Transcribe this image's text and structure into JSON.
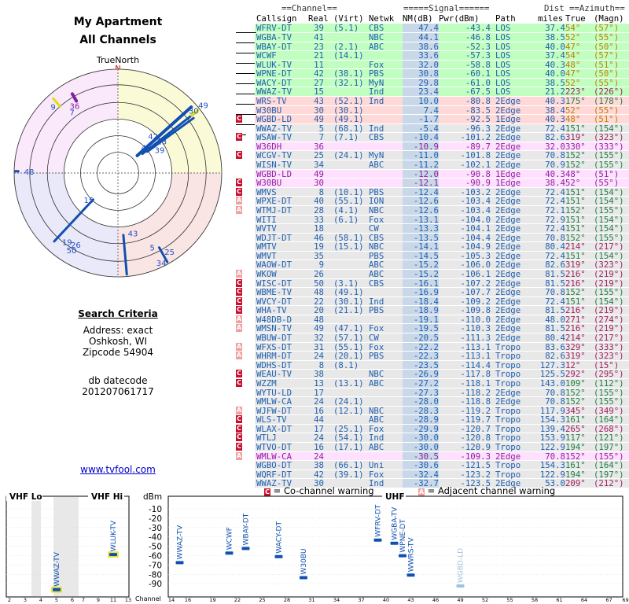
{
  "header": {
    "title1": "My Apartment",
    "title2": "All Channels",
    "truenorth": "TrueNorth",
    "north": "N"
  },
  "criteria": {
    "heading": "Search Criteria",
    "address": "Address: exact",
    "city": "Oshkosh, WI",
    "zip": "Zipcode 54904",
    "db1": "db datecode",
    "db2": "201207061717"
  },
  "link": "www.tvfool.com",
  "table_headers": {
    "g_channel": "==Channel==",
    "g_signal": "=====Signal======",
    "g_dist": "Dist",
    "g_azimuth": "==Azimuth==",
    "callsign": "Callsign",
    "real": "Real",
    "virt": "(Virt)",
    "netwk": "Netwk",
    "nm": "NM(dB)",
    "pwr": "Pwr(dBm)",
    "path": "Path",
    "miles": "miles",
    "true": "True",
    "magn": "(Magn)"
  },
  "colors": {
    "green": "#c0ffc0",
    "yellow": "#ffffc0",
    "red": "#ffd8d8",
    "pink": "#ffe0ff",
    "gray": "#e8e8e8",
    "nm_col": "#c8d8e8",
    "blue": "#2050c0",
    "text_blue": "#2060b0"
  },
  "stations": [
    {
      "call": "WFRV-DT",
      "real": "39",
      "virt": "(5.1)",
      "net": "CBS",
      "nm": "47.4",
      "pwr": "-43.4",
      "path": "LOS",
      "dist": "37.4",
      "az": "54°",
      "mag": "(57°)",
      "band": "green",
      "mark": ""
    },
    {
      "call": "WGBA-TV",
      "real": "41",
      "virt": "",
      "net": "NBC",
      "nm": "44.1",
      "pwr": "-46.8",
      "path": "LOS",
      "dist": "38.5",
      "az": "52°",
      "mag": "(55°)",
      "band": "green",
      "mark": ""
    },
    {
      "call": "WBAY-DT",
      "real": "23",
      "virt": "(2.1)",
      "net": "ABC",
      "nm": "38.6",
      "pwr": "-52.3",
      "path": "LOS",
      "dist": "40.0",
      "az": "47°",
      "mag": "(50°)",
      "band": "green",
      "mark": ""
    },
    {
      "call": "WCWF",
      "real": "21",
      "virt": "(14.1)",
      "net": "",
      "nm": "33.6",
      "pwr": "-57.3",
      "path": "LOS",
      "dist": "37.4",
      "az": "54°",
      "mag": "(57°)",
      "band": "green",
      "mark": ""
    },
    {
      "call": "WLUK-TV",
      "real": "11",
      "virt": "",
      "net": "Fox",
      "nm": "32.0",
      "pwr": "-58.8",
      "path": "LOS",
      "dist": "40.3",
      "az": "48°",
      "mag": "(51°)",
      "band": "green",
      "mark": ""
    },
    {
      "call": "WPNE-DT",
      "real": "42",
      "virt": "(38.1)",
      "net": "PBS",
      "nm": "30.8",
      "pwr": "-60.1",
      "path": "LOS",
      "dist": "40.0",
      "az": "47°",
      "mag": "(50°)",
      "band": "green",
      "mark": ""
    },
    {
      "call": "WACY-DT",
      "real": "27",
      "virt": "(32.1)",
      "net": "MyN",
      "nm": "29.8",
      "pwr": "-61.0",
      "path": "LOS",
      "dist": "38.5",
      "az": "52°",
      "mag": "(55°)",
      "band": "green",
      "mark": ""
    },
    {
      "call": "WWAZ-TV",
      "real": "15",
      "virt": "",
      "net": "Ind",
      "nm": "23.4",
      "pwr": "-67.5",
      "path": "LOS",
      "dist": "21.2",
      "az": "223°",
      "mag": "(226°)",
      "band": "green",
      "mark": ""
    },
    {
      "call": "WRS-TV",
      "real": "43",
      "virt": "(52.1)",
      "net": "Ind",
      "nm": "10.0",
      "pwr": "-80.8",
      "path": "2Edge",
      "dist": "40.3",
      "az": "175°",
      "mag": "(178°)",
      "band": "red",
      "mark": ""
    },
    {
      "call": "W30BU",
      "real": "30",
      "virt": "(30.1)",
      "net": "",
      "nm": "7.4",
      "pwr": "-83.5",
      "path": "2Edge",
      "dist": "38.4",
      "az": "52°",
      "mag": "(55°)",
      "band": "red",
      "mark": ""
    },
    {
      "call": "WGBD-LD",
      "real": "49",
      "virt": "(49.1)",
      "net": "",
      "nm": "-1.7",
      "pwr": "-92.5",
      "path": "1Edge",
      "dist": "40.3",
      "az": "48°",
      "mag": "(51°)",
      "band": "red",
      "mark": "C"
    },
    {
      "call": "WWAZ-TV",
      "real": "5",
      "virt": "(68.1)",
      "net": "Ind",
      "nm": "-5.4",
      "pwr": "-96.3",
      "path": "2Edge",
      "dist": "72.4",
      "az": "151°",
      "mag": "(154°)",
      "band": "gray",
      "mark": ""
    },
    {
      "call": "WSAW-TV",
      "real": "7",
      "virt": "(7.1)",
      "net": "CBS",
      "nm": "-10.4",
      "pwr": "-101.2",
      "path": "2Edge",
      "dist": "82.6",
      "az": "319°",
      "mag": "(323°)",
      "band": "gray",
      "mark": "C"
    },
    {
      "call": "W36DH",
      "real": "36",
      "virt": "",
      "net": "",
      "nm": "-10.9",
      "pwr": "-89.7",
      "path": "2Edge",
      "dist": "32.0",
      "az": "330°",
      "mag": "(333°)",
      "band": "pink",
      "mark": ""
    },
    {
      "call": "WCGV-TV",
      "real": "25",
      "virt": "(24.1)",
      "net": "MyN",
      "nm": "-11.0",
      "pwr": "-101.8",
      "path": "2Edge",
      "dist": "70.8",
      "az": "152°",
      "mag": "(155°)",
      "band": "gray",
      "mark": "C"
    },
    {
      "call": "WISN-TV",
      "real": "34",
      "virt": "",
      "net": "ABC",
      "nm": "-11.2",
      "pwr": "-102.1",
      "path": "2Edge",
      "dist": "70.9",
      "az": "152°",
      "mag": "(155°)",
      "band": "gray",
      "mark": ""
    },
    {
      "call": "WGBD-LD",
      "real": "49",
      "virt": "",
      "net": "",
      "nm": "-12.0",
      "pwr": "-90.8",
      "path": "1Edge",
      "dist": "40.3",
      "az": "48°",
      "mag": "(51°)",
      "band": "pink",
      "mark": ""
    },
    {
      "call": "W30BU",
      "real": "30",
      "virt": "",
      "net": "",
      "nm": "-12.1",
      "pwr": "-90.9",
      "path": "1Edge",
      "dist": "38.4",
      "az": "52°",
      "mag": "(55°)",
      "band": "pink",
      "mark": "C"
    },
    {
      "call": "WMVS",
      "real": "8",
      "virt": "(10.1)",
      "net": "PBS",
      "nm": "-12.4",
      "pwr": "-103.2",
      "path": "2Edge",
      "dist": "72.4",
      "az": "151°",
      "mag": "(154°)",
      "band": "gray",
      "mark": "C"
    },
    {
      "call": "WPXE-DT",
      "real": "40",
      "virt": "(55.1)",
      "net": "ION",
      "nm": "-12.6",
      "pwr": "-103.4",
      "path": "2Edge",
      "dist": "72.4",
      "az": "151°",
      "mag": "(154°)",
      "band": "gray",
      "mark": "A"
    },
    {
      "call": "WTMJ-DT",
      "real": "28",
      "virt": "(4.1)",
      "net": "NBC",
      "nm": "-12.6",
      "pwr": "-103.4",
      "path": "2Edge",
      "dist": "72.1",
      "az": "152°",
      "mag": "(155°)",
      "band": "gray",
      "mark": "A"
    },
    {
      "call": "WITI",
      "real": "33",
      "virt": "(6.1)",
      "net": "Fox",
      "nm": "-13.1",
      "pwr": "-104.0",
      "path": "2Edge",
      "dist": "72.9",
      "az": "151°",
      "mag": "(154°)",
      "band": "gray",
      "mark": ""
    },
    {
      "call": "WVTV",
      "real": "18",
      "virt": "",
      "net": "CW",
      "nm": "-13.3",
      "pwr": "-104.1",
      "path": "2Edge",
      "dist": "72.4",
      "az": "151°",
      "mag": "(154°)",
      "band": "gray",
      "mark": ""
    },
    {
      "call": "WDJT-DT",
      "real": "46",
      "virt": "(58.1)",
      "net": "CBS",
      "nm": "-13.5",
      "pwr": "-104.4",
      "path": "2Edge",
      "dist": "70.8",
      "az": "152°",
      "mag": "(155°)",
      "band": "gray",
      "mark": ""
    },
    {
      "call": "WMTV",
      "real": "19",
      "virt": "(15.1)",
      "net": "NBC",
      "nm": "-14.1",
      "pwr": "-104.9",
      "path": "2Edge",
      "dist": "80.4",
      "az": "214°",
      "mag": "(217°)",
      "band": "gray",
      "mark": ""
    },
    {
      "call": "WMVT",
      "real": "35",
      "virt": "",
      "net": "PBS",
      "nm": "-14.5",
      "pwr": "-105.3",
      "path": "2Edge",
      "dist": "72.4",
      "az": "151°",
      "mag": "(154°)",
      "band": "gray",
      "mark": ""
    },
    {
      "call": "WAOW-DT",
      "real": "9",
      "virt": "",
      "net": "ABC",
      "nm": "-15.2",
      "pwr": "-106.0",
      "path": "2Edge",
      "dist": "82.6",
      "az": "319°",
      "mag": "(323°)",
      "band": "gray",
      "mark": ""
    },
    {
      "call": "WKOW",
      "real": "26",
      "virt": "",
      "net": "ABC",
      "nm": "-15.2",
      "pwr": "-106.1",
      "path": "2Edge",
      "dist": "81.5",
      "az": "216°",
      "mag": "(219°)",
      "band": "gray",
      "mark": "A"
    },
    {
      "call": "WISC-DT",
      "real": "50",
      "virt": "(3.1)",
      "net": "CBS",
      "nm": "-16.1",
      "pwr": "-107.2",
      "path": "2Edge",
      "dist": "81.5",
      "az": "216°",
      "mag": "(219°)",
      "band": "gray",
      "mark": "C"
    },
    {
      "call": "WBME-TV",
      "real": "48",
      "virt": "(49.1)",
      "net": "",
      "nm": "-16.9",
      "pwr": "-107.7",
      "path": "2Edge",
      "dist": "70.8",
      "az": "152°",
      "mag": "(155°)",
      "band": "gray",
      "mark": "C"
    },
    {
      "call": "WVCY-DT",
      "real": "22",
      "virt": "(30.1)",
      "net": "Ind",
      "nm": "-18.4",
      "pwr": "-109.2",
      "path": "2Edge",
      "dist": "72.4",
      "az": "151°",
      "mag": "(154°)",
      "band": "gray",
      "mark": "C"
    },
    {
      "call": "WHA-TV",
      "real": "20",
      "virt": "(21.1)",
      "net": "PBS",
      "nm": "-18.9",
      "pwr": "-109.8",
      "path": "2Edge",
      "dist": "81.5",
      "az": "216°",
      "mag": "(219°)",
      "band": "gray",
      "mark": "C"
    },
    {
      "call": "W48DB-D",
      "real": "48",
      "virt": "",
      "net": "",
      "nm": "-19.1",
      "pwr": "-110.0",
      "path": "2Edge",
      "dist": "48.0",
      "az": "271°",
      "mag": "(274°)",
      "band": "gray",
      "mark": "A"
    },
    {
      "call": "WMSN-TV",
      "real": "49",
      "virt": "(47.1)",
      "net": "Fox",
      "nm": "-19.5",
      "pwr": "-110.3",
      "path": "2Edge",
      "dist": "81.5",
      "az": "216°",
      "mag": "(219°)",
      "band": "gray",
      "mark": "A"
    },
    {
      "call": "WBUW-DT",
      "real": "32",
      "virt": "(57.1)",
      "net": "CW",
      "nm": "-20.5",
      "pwr": "-111.3",
      "path": "2Edge",
      "dist": "80.4",
      "az": "214°",
      "mag": "(217°)",
      "band": "gray",
      "mark": ""
    },
    {
      "call": "WFXS-DT",
      "real": "31",
      "virt": "(55.1)",
      "net": "Fox",
      "nm": "-22.2",
      "pwr": "-113.1",
      "path": "Tropo",
      "dist": "83.6",
      "az": "329°",
      "mag": "(333°)",
      "band": "gray",
      "mark": "A"
    },
    {
      "call": "WHRM-DT",
      "real": "24",
      "virt": "(20.1)",
      "net": "PBS",
      "nm": "-22.3",
      "pwr": "-113.1",
      "path": "Tropo",
      "dist": "82.6",
      "az": "319°",
      "mag": "(323°)",
      "band": "gray",
      "mark": "A"
    },
    {
      "call": "WDHS-DT",
      "real": "8",
      "virt": "(8.1)",
      "net": "",
      "nm": "-23.5",
      "pwr": "-114.4",
      "path": "Tropo",
      "dist": "127.3",
      "az": "12°",
      "mag": "(15°)",
      "band": "gray",
      "mark": ""
    },
    {
      "call": "WEAU-TV",
      "real": "38",
      "virt": "",
      "net": "NBC",
      "nm": "-26.9",
      "pwr": "-117.8",
      "path": "Tropo",
      "dist": "125.5",
      "az": "292°",
      "mag": "(295°)",
      "band": "gray",
      "mark": "C"
    },
    {
      "call": "WZZM",
      "real": "13",
      "virt": "(13.1)",
      "net": "ABC",
      "nm": "-27.2",
      "pwr": "-118.1",
      "path": "Tropo",
      "dist": "143.0",
      "az": "109°",
      "mag": "(112°)",
      "band": "gray",
      "mark": "C"
    },
    {
      "call": "WYTU-LD",
      "real": "17",
      "virt": "",
      "net": "",
      "nm": "-27.3",
      "pwr": "-118.2",
      "path": "2Edge",
      "dist": "70.8",
      "az": "152°",
      "mag": "(155°)",
      "band": "gray",
      "mark": ""
    },
    {
      "call": "WMLW-CA",
      "real": "24",
      "virt": "(24.1)",
      "net": "",
      "nm": "-28.0",
      "pwr": "-118.8",
      "path": "2Edge",
      "dist": "70.8",
      "az": "152°",
      "mag": "(155°)",
      "band": "gray",
      "mark": ""
    },
    {
      "call": "WJFW-DT",
      "real": "16",
      "virt": "(12.1)",
      "net": "NBC",
      "nm": "-28.3",
      "pwr": "-119.2",
      "path": "Tropo",
      "dist": "117.9",
      "az": "345°",
      "mag": "(349°)",
      "band": "gray",
      "mark": "A"
    },
    {
      "call": "WLS-TV",
      "real": "44",
      "virt": "",
      "net": "ABC",
      "nm": "-28.9",
      "pwr": "-119.7",
      "path": "Tropo",
      "dist": "154.3",
      "az": "161°",
      "mag": "(164°)",
      "band": "gray",
      "mark": "C"
    },
    {
      "call": "WLAX-DT",
      "real": "17",
      "virt": "(25.1)",
      "net": "Fox",
      "nm": "-29.9",
      "pwr": "-120.7",
      "path": "Tropo",
      "dist": "139.4",
      "az": "265°",
      "mag": "(268°)",
      "band": "gray",
      "mark": "C"
    },
    {
      "call": "WTLJ",
      "real": "24",
      "virt": "(54.1)",
      "net": "Ind",
      "nm": "-30.0",
      "pwr": "-120.8",
      "path": "Tropo",
      "dist": "153.9",
      "az": "117°",
      "mag": "(121°)",
      "band": "gray",
      "mark": "C"
    },
    {
      "call": "WTVO-DT",
      "real": "16",
      "virt": "(17.1)",
      "net": "ABC",
      "nm": "-30.0",
      "pwr": "-120.9",
      "path": "Tropo",
      "dist": "122.9",
      "az": "194°",
      "mag": "(197°)",
      "band": "gray",
      "mark": "C"
    },
    {
      "call": "WMLW-CA",
      "real": "24",
      "virt": "",
      "net": "",
      "nm": "-30.5",
      "pwr": "-109.3",
      "path": "2Edge",
      "dist": "70.8",
      "az": "152°",
      "mag": "(155°)",
      "band": "pink",
      "mark": "A"
    },
    {
      "call": "WGBO-DT",
      "real": "38",
      "virt": "(66.1)",
      "net": "Uni",
      "nm": "-30.6",
      "pwr": "-121.5",
      "path": "Tropo",
      "dist": "154.3",
      "az": "161°",
      "mag": "(164°)",
      "band": "gray",
      "mark": ""
    },
    {
      "call": "WQRF-DT",
      "real": "42",
      "virt": "(39.1)",
      "net": "Fox",
      "nm": "-32.4",
      "pwr": "-123.2",
      "path": "Tropo",
      "dist": "122.9",
      "az": "194°",
      "mag": "(197°)",
      "band": "gray",
      "mark": ""
    },
    {
      "call": "WWAZ-TV",
      "real": "30",
      "virt": "",
      "net": "Ind",
      "nm": "-32.7",
      "pwr": "-123.5",
      "path": "2Edge",
      "dist": "53.0",
      "az": "209°",
      "mag": "(212°)",
      "band": "gray",
      "mark": ""
    }
  ],
  "radar_labels": [
    {
      "text": "36",
      "az": 330,
      "r": 0.75,
      "color": "#8020a0"
    },
    {
      "text": "39",
      "az": 54,
      "r": 0.38,
      "color": "#2050c0"
    },
    {
      "text": "41",
      "az": 52,
      "r": 0.4,
      "color": "#2050c0"
    },
    {
      "text": "23",
      "az": 47,
      "r": 0.45,
      "color": "#2050c0"
    },
    {
      "text": "42",
      "az": 47,
      "r": 0.52,
      "color": "#2050c0"
    },
    {
      "text": "49",
      "az": 48,
      "r": 0.98,
      "color": "#2050c0"
    },
    {
      "text": "30",
      "az": 52,
      "r": 0.98,
      "color": "#2050c0"
    },
    {
      "text": "48",
      "az": 271,
      "r": 0.95,
      "color": "#2050c0"
    },
    {
      "text": "15",
      "az": 223,
      "r": 0.35,
      "color": "#2050c0"
    },
    {
      "text": "43",
      "az": 175,
      "r": 0.58,
      "color": "#2050c0"
    },
    {
      "text": "5",
      "az": 151,
      "r": 0.82,
      "color": "#2050c0"
    },
    {
      "text": "25",
      "az": 152,
      "r": 0.86,
      "color": "#2050c0"
    },
    {
      "text": "34",
      "az": 152,
      "r": 0.98,
      "color": "#2050c0"
    },
    {
      "text": "26",
      "az": 216,
      "r": 0.85,
      "color": "#2050c0"
    },
    {
      "text": "19",
      "az": 214,
      "r": 0.8,
      "color": "#2050c0"
    },
    {
      "text": "50",
      "az": 216,
      "r": 0.92,
      "color": "#2050c0"
    },
    {
      "text": "9",
      "az": 319,
      "r": 0.85,
      "color": "#2050c0"
    },
    {
      "text": "7",
      "az": 319,
      "r": 0.78,
      "color": "#2050c0"
    }
  ],
  "bottom": {
    "vhf_lo": "VHF Lo",
    "vhf_hi": "VHF Hi",
    "uhf": "UHF",
    "dbm": "dBm",
    "channel": "Channel",
    "legend_co": "= Co-channel warning",
    "legend_adj": "= Adjacent channel warning",
    "legend_c": "C",
    "legend_a": "A",
    "dbm_ticks": [
      "-10",
      "-20",
      "-30",
      "-40",
      "-50",
      "-60",
      "-70",
      "-80",
      "-90"
    ],
    "vhf_lo_ticks": [
      "2",
      "3",
      "4",
      "5",
      "6"
    ],
    "vhf_hi_ticks": [
      "7",
      "9",
      "11",
      "13"
    ],
    "uhf_ticks": [
      "14",
      "16",
      "19",
      "22",
      "25",
      "28",
      "31",
      "34",
      "37",
      "40",
      "43",
      "46",
      "49",
      "52",
      "55",
      "58",
      "61",
      "64",
      "67",
      "69"
    ],
    "bars": [
      {
        "ch": 5,
        "dbm": -96.3,
        "label": "WWAZ-TV",
        "color": "#1050b0"
      },
      {
        "ch": 11,
        "dbm": -58.8,
        "label": "WLUK-TV",
        "color": "#1050b0"
      },
      {
        "ch": 15,
        "dbm": -67.5,
        "label": "WWAZ-TV",
        "color": "#1050b0"
      },
      {
        "ch": 21,
        "dbm": -57.3,
        "label": "WCWF",
        "color": "#1050b0"
      },
      {
        "ch": 23,
        "dbm": -52.3,
        "label": "WBAY-DT",
        "color": "#1050b0"
      },
      {
        "ch": 27,
        "dbm": -61.0,
        "label": "WACY-DT",
        "color": "#1050b0"
      },
      {
        "ch": 30,
        "dbm": -83.5,
        "label": "W30BU",
        "color": "#1050b0"
      },
      {
        "ch": 39,
        "dbm": -43.4,
        "label": "WFRV-DT",
        "color": "#1050b0"
      },
      {
        "ch": 41,
        "dbm": -46.8,
        "label": "WGBA-TV",
        "color": "#1050b0"
      },
      {
        "ch": 42,
        "dbm": -60.1,
        "label": "WPNE-DT",
        "color": "#1050b0"
      },
      {
        "ch": 43,
        "dbm": -80.8,
        "label": "WWRS-TV",
        "color": "#1050b0"
      },
      {
        "ch": 49,
        "dbm": -92.5,
        "label": "WGBD-LD",
        "color": "#a0c0e0"
      }
    ]
  }
}
